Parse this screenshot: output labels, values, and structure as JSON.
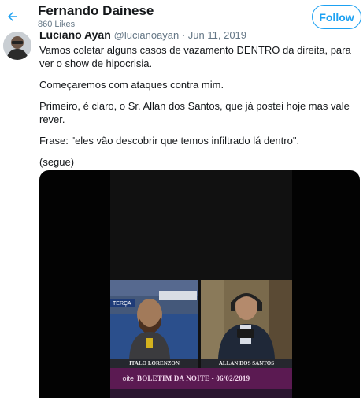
{
  "header": {
    "title": "Fernando Dainese",
    "subtitle": "860 Likes",
    "follow_label": "Follow",
    "back_icon": "arrow-left-icon",
    "accent_color": "#1da1f2"
  },
  "tweet": {
    "author_name": "Luciano Ayan",
    "handle_and_date": "@lucianoayan · Jun 11, 2019",
    "paragraphs": [
      "Vamos coletar alguns casos de vazamento DENTRO da direita, para ver o show de hipocrisia.",
      "Começaremos com ataques contra mim.",
      "Primeiro, é claro, o Sr. Allan dos Santos, que já postei hoje mas vale rever.",
      "Frase: \"eles vão descobrir que temos infiltrado lá dentro\".",
      "(segue)"
    ]
  },
  "media": {
    "left_name": "ITALO LORENZON",
    "right_name": "ALLAN DOS SANTOS",
    "left_tag": "TERÇA",
    "bar_left": "oite",
    "bar_right": "BOLETIM DA NOITE - 06/02/2019",
    "bar_color": "#5b1a52"
  }
}
